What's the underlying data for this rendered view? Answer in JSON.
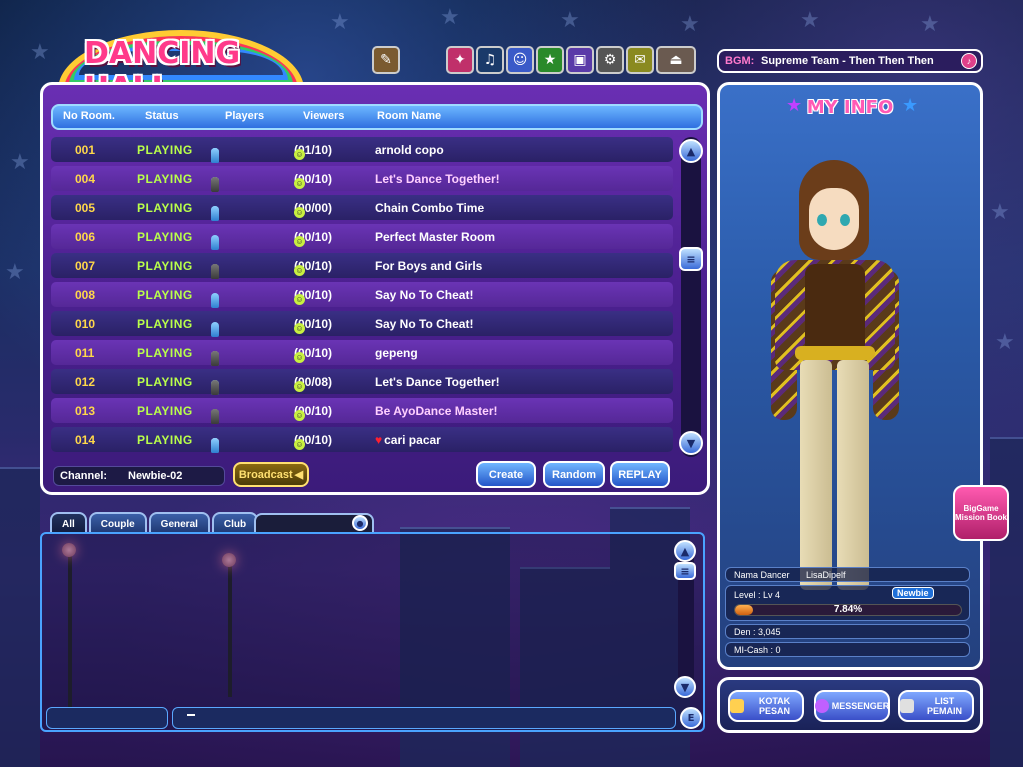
{
  "logo": {
    "text": "DANCING HALL"
  },
  "bgm": {
    "label": "BGM:",
    "track": "Supreme Team - Then Then Then"
  },
  "top_icons": [
    "book-icon",
    "gift-icon",
    "game-icon",
    "character-icon",
    "star-icon",
    "shop-tv-icon",
    "settings-icon",
    "scroll-icon",
    "exit-icon"
  ],
  "room_table": {
    "headers": [
      "No Room.",
      "Status",
      "Players",
      "Viewers",
      "Room Name"
    ],
    "rows": [
      {
        "no": "001",
        "status": "PLAYING",
        "players": [
          "b",
          "b",
          "b",
          "b"
        ],
        "viewers": "(01/10)",
        "name": "arnold copo",
        "highlight": false
      },
      {
        "no": "004",
        "status": "PLAYING",
        "players": [
          "r",
          "b",
          "b",
          "b",
          "g",
          "g"
        ],
        "viewers": "(00/10)",
        "name": "Let's Dance Together!",
        "highlight": true
      },
      {
        "no": "005",
        "status": "PLAYING",
        "players": [
          "b",
          "b"
        ],
        "viewers": "(00/00)",
        "name": "Chain Combo Time",
        "highlight": false
      },
      {
        "no": "006",
        "status": "PLAYING",
        "players": [
          "b"
        ],
        "viewers": "(00/10)",
        "name": "Perfect Master Room",
        "highlight": false
      },
      {
        "no": "007",
        "status": "PLAYING",
        "players": [
          "b",
          "g",
          "g",
          "g",
          "g",
          "g"
        ],
        "viewers": "(00/10)",
        "name": "For Boys and Girls",
        "highlight": false
      },
      {
        "no": "008",
        "status": "PLAYING",
        "players": [
          "b"
        ],
        "viewers": "(00/10)",
        "name": "Say No To Cheat!",
        "highlight": false
      },
      {
        "no": "010",
        "status": "PLAYING",
        "players": [
          "b"
        ],
        "viewers": "(00/10)",
        "name": "Say No To Cheat!",
        "highlight": false
      },
      {
        "no": "011",
        "status": "PLAYING",
        "players": [
          "r",
          "r",
          "b",
          "g",
          "g"
        ],
        "viewers": "(00/10)",
        "name": "gepeng",
        "highlight": false
      },
      {
        "no": "012",
        "status": "PLAYING",
        "players": [
          "b",
          "b",
          "g"
        ],
        "viewers": "(00/08)",
        "name": "Let's Dance Together!",
        "highlight": false
      },
      {
        "no": "013",
        "status": "PLAYING",
        "players": [
          "b",
          "g",
          "g",
          "g",
          "g",
          "g"
        ],
        "viewers": "(00/10)",
        "name": "Be AyoDance Master!",
        "highlight": true
      },
      {
        "no": "014",
        "status": "PLAYING",
        "players": [
          "r",
          "r",
          "r",
          "b",
          "b",
          "b"
        ],
        "viewers": "(00/10)",
        "name": "cari pacar",
        "highlight": false,
        "heart": true
      }
    ]
  },
  "channel": {
    "label": "Channel:",
    "value": "Newbie-02"
  },
  "buttons": {
    "broadcast": "Broadcast",
    "create": "Create",
    "random": "Random",
    "replay": "REPLAY"
  },
  "chat_tabs": [
    "All",
    "Couple",
    "General",
    "Club"
  ],
  "info": {
    "title": "MY INFO",
    "dancer_label": "Nama Dancer",
    "dancer_name": "LisaDipelf",
    "level_label": "Level : Lv 4",
    "badge": "Newbie",
    "progress_text": "7.84%",
    "progress_value": 0.0784,
    "den": "Den : 3,045",
    "mcash": "MI-Cash : 0"
  },
  "mission_book": "BigGame Mission Book",
  "bottom_buttons": {
    "kotak": "KOTAK PESAN",
    "messenger": "MESSENGER",
    "list": "LIST PEMAIN"
  },
  "colors": {
    "accent": "#ff3a8a",
    "playing": "#b9ff4a",
    "room_no": "#ffd84a",
    "panel_border": "#ffffff"
  }
}
